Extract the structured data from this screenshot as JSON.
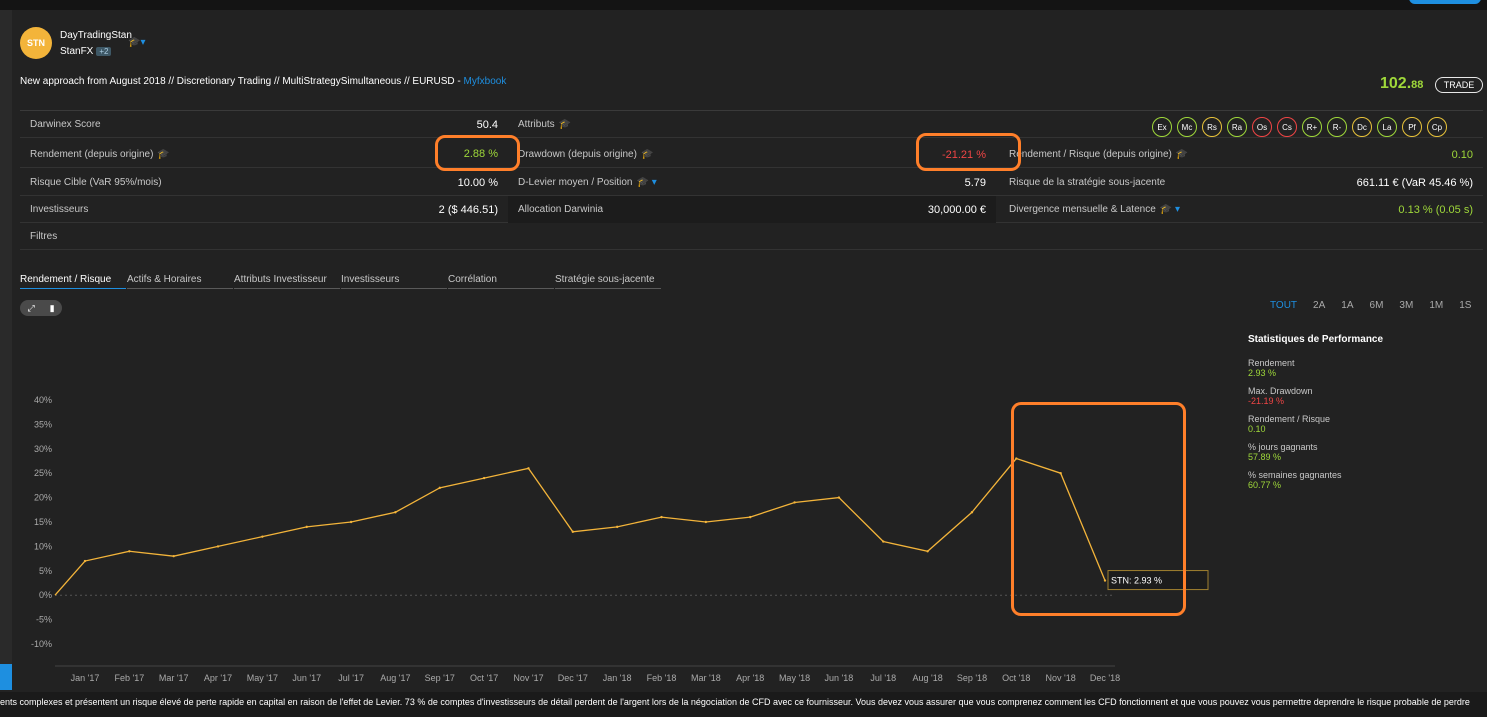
{
  "header": {
    "avatar": "STN",
    "user": "DayTradingStan",
    "strategy": "StanFX",
    "strategy_badge": "+2",
    "description": "New approach from August 2018 // Discretionary Trading // MultiStrategySimultaneous // EURUSD - ",
    "link": "Myfxbook",
    "price_int": "102.",
    "price_dec": "88",
    "trade": "TRADE"
  },
  "metrics": {
    "darwinex_score_label": "Darwinex Score",
    "darwinex_score": "50.4",
    "attributs_label": "Attributs",
    "rendement_label": "Rendement (depuis origine)",
    "rendement": "2.88 %",
    "drawdown_label": "Drawdown (depuis origine)",
    "drawdown": "-21.21 %",
    "rr_label": "Rendement / Risque (depuis origine)",
    "rr": "0.10",
    "risque_label": "Risque Cible (VaR 95%/mois)",
    "risque": "10.00 %",
    "dlevier_label": "D-Levier moyen / Position",
    "dlevier": "5.79",
    "sous_jacente_label": "Risque de la stratégie sous-jacente",
    "sous_jacente": "661.11 € (VaR 45.46 %)",
    "investisseurs_label": "Investisseurs",
    "investisseurs": "2 ($ 446.51)",
    "allocation_label": "Allocation Darwinia",
    "allocation": "30,000.00 €",
    "divergence_label": "Divergence mensuelle & Latence",
    "divergence": "0.13 % (0.05 s)",
    "filtres_label": "Filtres"
  },
  "badges": [
    {
      "t": "Ex",
      "c": "#9fd83a"
    },
    {
      "t": "Mc",
      "c": "#9fd83a"
    },
    {
      "t": "Rs",
      "c": "#e8c33a"
    },
    {
      "t": "Ra",
      "c": "#9fd83a"
    },
    {
      "t": "Os",
      "c": "#f04545"
    },
    {
      "t": "Cs",
      "c": "#f04545"
    },
    {
      "t": "R+",
      "c": "#9fd83a"
    },
    {
      "t": "R-",
      "c": "#9fd83a"
    },
    {
      "t": "Dc",
      "c": "#e8c33a"
    },
    {
      "t": "La",
      "c": "#9fd83a"
    },
    {
      "t": "Pf",
      "c": "#e8c33a"
    },
    {
      "t": "Cp",
      "c": "#e8c33a"
    }
  ],
  "tabs": [
    "Rendement / Risque",
    "Actifs & Horaires",
    "Attributs Investisseur",
    "Investisseurs",
    "Corrélation",
    "Stratégie sous-jacente"
  ],
  "ranges": [
    "TOUT",
    "2A",
    "1A",
    "6M",
    "3M",
    "1M",
    "1S",
    "1J"
  ],
  "stats": {
    "title": "Statistiques de Performance",
    "items": [
      {
        "label": "Rendement",
        "value": "2.93 %"
      },
      {
        "label": "Max. Drawdown",
        "value": "-21.19 %"
      },
      {
        "label": "Rendement / Risque",
        "value": "0.10"
      },
      {
        "label": "% jours gagnants",
        "value": "57.89 %"
      },
      {
        "label": "% semaines gagnantes",
        "value": "60.77 %"
      }
    ]
  },
  "chart_data": {
    "type": "line",
    "series": [
      {
        "name": "STN",
        "color": "#f3b43a",
        "x": [
          "Jan '17",
          "Feb '17",
          "Mar '17",
          "Apr '17",
          "May '17",
          "Jun '17",
          "Jul '17",
          "Aug '17",
          "Sep '17",
          "Oct '17",
          "Nov '17",
          "Dec '17",
          "Jan '18",
          "Feb '18",
          "Mar '18",
          "Apr '18",
          "May '18",
          "Jun '18",
          "Jul '18",
          "Aug '18",
          "Sep '18",
          "Oct '18",
          "Nov '18",
          "Dec '18"
        ],
        "values": [
          7,
          9,
          8,
          10,
          12,
          14,
          15,
          17,
          22,
          24,
          26,
          13,
          14,
          16,
          15,
          16,
          19,
          20,
          11,
          9,
          17,
          28,
          25,
          3
        ]
      }
    ],
    "yticks": [
      "40%",
      "35%",
      "30%",
      "25%",
      "20%",
      "15%",
      "10%",
      "5%",
      "0%",
      "-5%",
      "-10%"
    ],
    "ylim": [
      -10,
      40
    ],
    "tooltip": "STN: 2.93 %"
  },
  "disclaimer": "ents complexes et présentent un risque élevé de perte rapide en capital en raison de l'effet de Levier. 73 % de comptes d'investisseurs de détail perdent de l'argent lors de la négociation de CFD avec ce fournisseur. Vous devez vous assurer que vous comprenez comment les CFD fonctionnent et que vous pouvez vous permettre deprendre le risque probable de perdre"
}
